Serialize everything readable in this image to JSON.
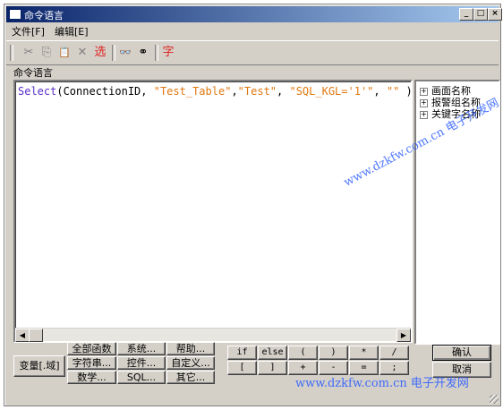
{
  "window": {
    "title": "命令语言"
  },
  "titlebar_buttons": {
    "minimize": "_",
    "maximize": "□",
    "close": "×"
  },
  "menu": [
    "文件[F]",
    "编辑[E]"
  ],
  "toolbar": {
    "items": [
      {
        "icon": "cut-icon",
        "glyph": "✂"
      },
      {
        "icon": "copy-icon",
        "glyph": "⎘"
      },
      {
        "icon": "paste-icon",
        "glyph": "📋"
      },
      {
        "icon": "delete-icon",
        "glyph": "✕"
      },
      {
        "icon": "select-icon",
        "glyph": "选"
      },
      {
        "icon": "find-icon",
        "glyph": "👓"
      },
      {
        "icon": "replace-icon",
        "glyph": "⚭"
      },
      {
        "icon": "font-icon",
        "glyph": "字"
      }
    ]
  },
  "editor": {
    "label": "命令语言",
    "code": {
      "func": "Select",
      "p1": "(ConnectionID, ",
      "s1": "\"Test_Table\"",
      "c1": ",",
      "s2": "\"Test\"",
      "c2": ", ",
      "s3": "\"SQL_KGL='1'\"",
      "c3": ", ",
      "s4": "\"\"",
      "end": " );"
    }
  },
  "tree": [
    "画面名称",
    "报警组名称",
    "关键字名称"
  ],
  "buttons": {
    "variable": "变量[.域]",
    "grid": [
      [
        "全部函数",
        "系统...",
        "帮助..."
      ],
      [
        "字符串...",
        "控件...",
        "自定义..."
      ],
      [
        "数学...",
        "SQL...",
        "其它..."
      ]
    ],
    "symbols": [
      [
        "if",
        "else",
        "(",
        ")",
        "*",
        "/"
      ],
      [
        "[",
        "]",
        "+",
        "-",
        "=",
        ";"
      ]
    ],
    "ok": "确认",
    "cancel": "取消"
  },
  "watermarks": {
    "diagonal": "www.dzkfw.com.cn 电子开发网",
    "bottom": "www.dzkfw.com.cn 电子开发网"
  },
  "colors": {
    "keyword": "#5a2fc8",
    "string": "#e07810",
    "titlebar": "#0a246a",
    "watermark": "#3060ff"
  }
}
